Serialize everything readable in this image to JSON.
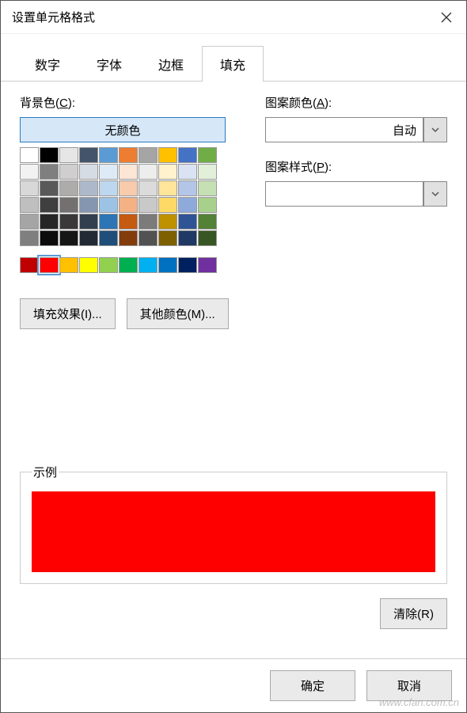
{
  "window": {
    "title": "设置单元格格式"
  },
  "tabs": {
    "t0": "数字",
    "t1": "字体",
    "t2": "边框",
    "t3": "填充"
  },
  "labels": {
    "bgcolor_pre": "背景色(",
    "bgcolor_u": "C",
    "bgcolor_post": "):",
    "nocolor": "无颜色",
    "fillfx_pre": "填充效果(",
    "fillfx_u": "I",
    "fillfx_post": ")...",
    "morecolor_pre": "其他颜色(",
    "morecolor_u": "M",
    "morecolor_post": ")...",
    "patcolor_pre": "图案颜色(",
    "patcolor_u": "A",
    "patcolor_post": "):",
    "patcolor_val": "自动",
    "patstyle_val": "",
    "patstyle_pre": "图案样式(",
    "patstyle_u": "P",
    "patstyle_post": "):",
    "sample": "示例",
    "clear_pre": "清除(",
    "clear_u": "R",
    "clear_post": ")"
  },
  "footer": {
    "ok": "确定",
    "cancel": "取消"
  },
  "sample_color": "#fe0000",
  "watermark": "www.cfan.com.cn",
  "palette_row1": [
    "#ffffff",
    "#000000",
    "#e7e6e6",
    "#44546a",
    "#5b9bd5",
    "#ed7d31",
    "#a5a5a5",
    "#ffc000",
    "#4472c4",
    "#70ad47"
  ],
  "palette_row2": [
    "#f2f2f2",
    "#7f7f7f",
    "#d0cece",
    "#d6dce4",
    "#deebf6",
    "#fbe5d5",
    "#ededed",
    "#fff2cc",
    "#dae3f3",
    "#e2efd9"
  ],
  "palette_row3": [
    "#d8d8d8",
    "#595959",
    "#aeabab",
    "#adb9ca",
    "#bdd7ee",
    "#f7cbac",
    "#dbdbdb",
    "#fee599",
    "#b4c6e7",
    "#c5e0b3"
  ],
  "palette_row4": [
    "#bfbfbf",
    "#3f3f3f",
    "#757070",
    "#8496b0",
    "#9cc3e5",
    "#f4b183",
    "#c9c9c9",
    "#ffd965",
    "#8eaadb",
    "#a8d08d"
  ],
  "palette_row5": [
    "#a5a5a5",
    "#262626",
    "#3a3838",
    "#323f4f",
    "#2e75b5",
    "#c55a11",
    "#7b7b7b",
    "#bf9000",
    "#2f5496",
    "#538135"
  ],
  "palette_row6": [
    "#7f7f7f",
    "#0c0c0c",
    "#171616",
    "#222a35",
    "#1e4e79",
    "#833c0b",
    "#525252",
    "#7f6000",
    "#1f3864",
    "#375623"
  ],
  "palette_std": [
    "#c00000",
    "#ff0000",
    "#ffc000",
    "#ffff00",
    "#92d050",
    "#00b050",
    "#00b0f0",
    "#0070c0",
    "#002060",
    "#7030a0"
  ],
  "selected_color": "#ff0000"
}
